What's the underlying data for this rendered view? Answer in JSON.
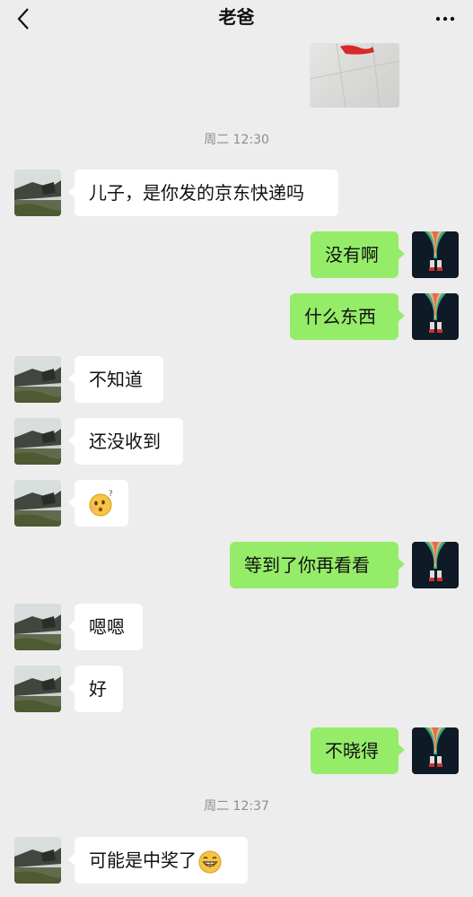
{
  "header": {
    "title": "老爸"
  },
  "timestamps": [
    "周二 12:30",
    "周二 12:37"
  ],
  "messages": [
    {
      "from": "dad",
      "text": "儿子，是你发的京东快递吗"
    },
    {
      "from": "me",
      "text": "没有啊"
    },
    {
      "from": "me",
      "text": "什么东西"
    },
    {
      "from": "dad",
      "text": "不知道"
    },
    {
      "from": "dad",
      "text": "还没收到"
    },
    {
      "from": "dad",
      "emoji": "confused-face-emoji"
    },
    {
      "from": "me",
      "text": "等到了你再看看"
    },
    {
      "from": "dad",
      "text": "嗯嗯"
    },
    {
      "from": "dad",
      "text": "好"
    },
    {
      "from": "me",
      "text": "不晓得"
    },
    {
      "from": "dad",
      "text": "可能是中奖了",
      "emoji": "grinning-face-emoji"
    }
  ],
  "icons": {
    "back": "chevron-left-icon",
    "more": "more-dots-icon"
  },
  "colors": {
    "background": "#ededed",
    "my_bubble": "#95ec69",
    "their_bubble": "#ffffff"
  }
}
